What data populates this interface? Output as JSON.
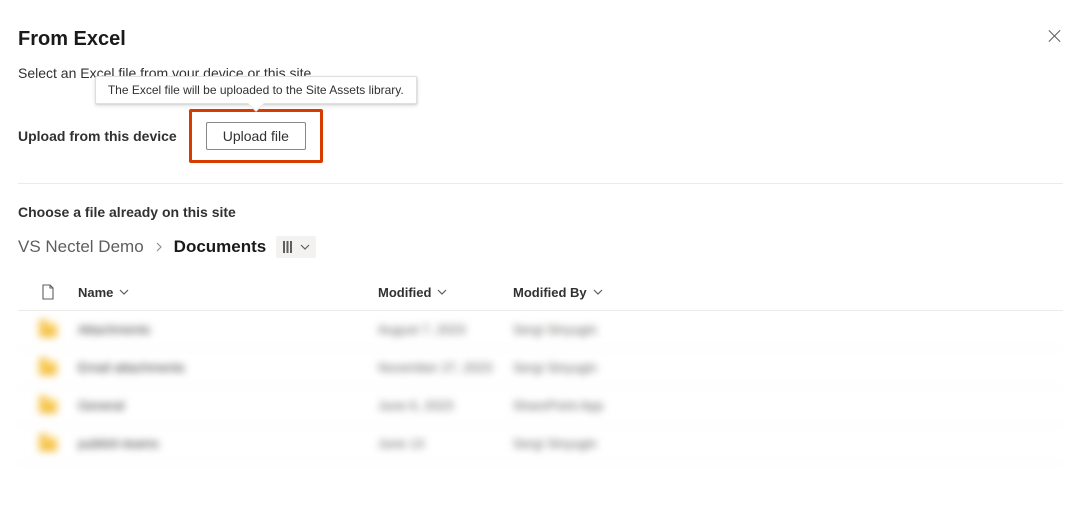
{
  "header": {
    "title": "From Excel",
    "subtitle": "Select an Excel file from your device or this site."
  },
  "upload": {
    "label": "Upload from this device",
    "button": "Upload file",
    "tooltip": "The Excel file will be uploaded to the Site Assets library."
  },
  "picker": {
    "section_label": "Choose a file already on this site",
    "breadcrumbs": {
      "root": "VS Nectel Demo",
      "current": "Documents"
    },
    "columns": {
      "name": "Name",
      "modified": "Modified",
      "modified_by": "Modified By"
    },
    "rows": [
      {
        "name": "Attachments",
        "modified": "August 7, 2023",
        "by": "Sergi Sinyugin"
      },
      {
        "name": "Email attachments",
        "modified": "November 27, 2023",
        "by": "Sergi Sinyugin"
      },
      {
        "name": "General",
        "modified": "June 6, 2023",
        "by": "SharePoint App"
      },
      {
        "name": "publish-teams",
        "modified": "June 13",
        "by": "Sergi Sinyugin"
      }
    ]
  }
}
